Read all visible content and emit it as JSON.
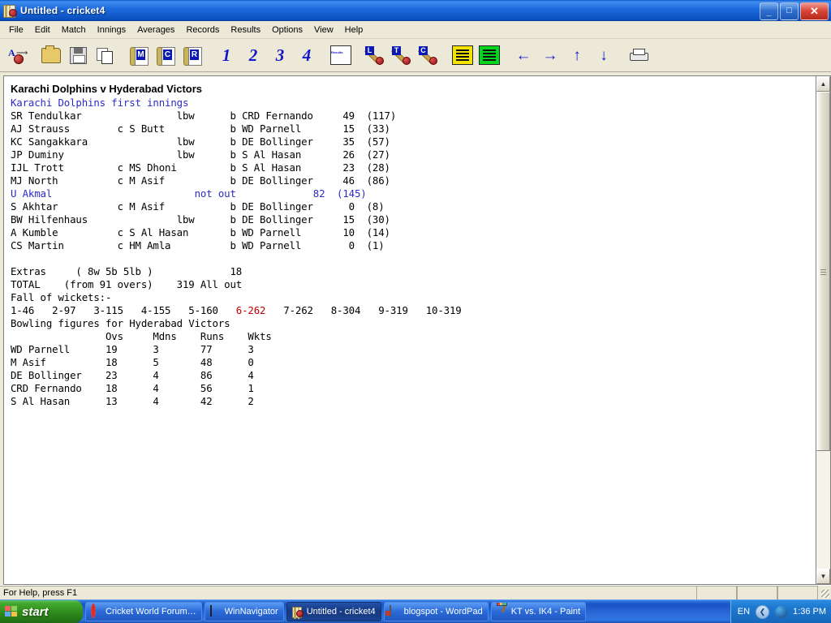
{
  "window": {
    "title": "Untitled - cricket4",
    "icon": "cricket-book-icon",
    "buttons": {
      "minimize": "_",
      "maximize": "□",
      "close": "✕"
    }
  },
  "menu": [
    "File",
    "Edit",
    "Match",
    "Innings",
    "Averages",
    "Records",
    "Results",
    "Options",
    "View",
    "Help"
  ],
  "toolbar": [
    {
      "name": "spell-check-ball-button",
      "kind": "aball",
      "label": "A"
    },
    {
      "name": "open-button",
      "kind": "folder"
    },
    {
      "name": "save-button",
      "kind": "disk"
    },
    {
      "name": "copy-button",
      "kind": "copy"
    },
    {
      "name": "match-book-button",
      "kind": "book",
      "label": "M"
    },
    {
      "name": "club-book-button",
      "kind": "book",
      "label": "C"
    },
    {
      "name": "records-book-button",
      "kind": "book",
      "label": "R"
    },
    {
      "name": "innings-1-button",
      "kind": "num",
      "label": "1"
    },
    {
      "name": "innings-2-button",
      "kind": "num",
      "label": "2"
    },
    {
      "name": "innings-3-button",
      "kind": "num",
      "label": "3"
    },
    {
      "name": "innings-4-button",
      "kind": "num",
      "label": "4"
    },
    {
      "name": "results-table-button",
      "kind": "results",
      "label": "Results"
    },
    {
      "name": "league-bat-button",
      "kind": "bat",
      "label": "L"
    },
    {
      "name": "table-bat-button",
      "kind": "bat",
      "label": "T"
    },
    {
      "name": "cup-bat-button",
      "kind": "bat",
      "label": "C"
    },
    {
      "name": "scoreboard-yellow-button",
      "kind": "score-y"
    },
    {
      "name": "scoreboard-green-button",
      "kind": "score-g"
    },
    {
      "name": "back-button",
      "kind": "arrow",
      "label": "←"
    },
    {
      "name": "forward-button",
      "kind": "arrow",
      "label": "→"
    },
    {
      "name": "up-button",
      "kind": "arrow",
      "label": "↑"
    },
    {
      "name": "down-button",
      "kind": "arrow",
      "label": "↓"
    },
    {
      "name": "print-button",
      "kind": "printer"
    }
  ],
  "document": {
    "match_title": "Karachi Dolphins v Hyderabad Victors",
    "innings_title": "Karachi Dolphins first innings",
    "scorecard_text": "SR Tendulkar                lbw      b CRD Fernando     49  (117)\nAJ Strauss        c S Butt           b WD Parnell       15  (33)\nKC Sangakkara               lbw      b DE Bollinger     35  (57)\nJP Duminy                   lbw      b S Al Hasan       26  (27)\nIJL Trott         c MS Dhoni         b S Al Hasan       23  (28)\nMJ North          c M Asif           b DE Bollinger     46  (86)",
    "not_out_line": "U Akmal                        not out             82  (145)",
    "scorecard_text2": "S Akhtar          c M Asif           b DE Bollinger      0  (8)\nBW Hilfenhaus               lbw      b DE Bollinger     15  (30)\nA Kumble          c S Al Hasan       b WD Parnell       10  (14)\nCS Martin         c HM Amla          b WD Parnell        0  (1)",
    "extras_line": "Extras     ( 8w 5b 5lb )             18",
    "total_line": "TOTAL    (from 91 overs)    319 All out",
    "fow_label": "Fall of wickets:-",
    "fow_before": "1-46   2-97   3-115   4-155   5-160   ",
    "fow_highlight": "6-262",
    "fow_after": "   7-262   8-304   9-319   10-319",
    "bowling_title": "Bowling figures for Hyderabad Victors",
    "bowling_header": "                Ovs     Mdns    Runs    Wkts",
    "bowling_rows": "WD Parnell      19      3       77      3\nM Asif          18      5       48      0\nDE Bollinger    23      4       86      4\nCRD Fernando    18      4       56      1\nS Al Hasan      13      4       42      2"
  },
  "statusbar": {
    "hint": "For Help, press F1"
  },
  "taskbar": {
    "start_label": "start",
    "items": [
      {
        "label": "Cricket World Forum…",
        "icon": "opera-icon",
        "active": false
      },
      {
        "label": "WinNavigator",
        "icon": "window-icon",
        "active": false
      },
      {
        "label": "Untitled - cricket4",
        "icon": "cricket-book-icon",
        "active": true
      },
      {
        "label": "blogspot - WordPad",
        "icon": "wordpad-icon",
        "active": false
      },
      {
        "label": "KT vs. IK4 - Paint",
        "icon": "paint-icon",
        "active": false
      }
    ],
    "tray": {
      "language": "EN",
      "chevron": "❮",
      "clock": "1:36 PM"
    }
  },
  "scrollbar": {
    "up": "▲",
    "down": "▼"
  }
}
